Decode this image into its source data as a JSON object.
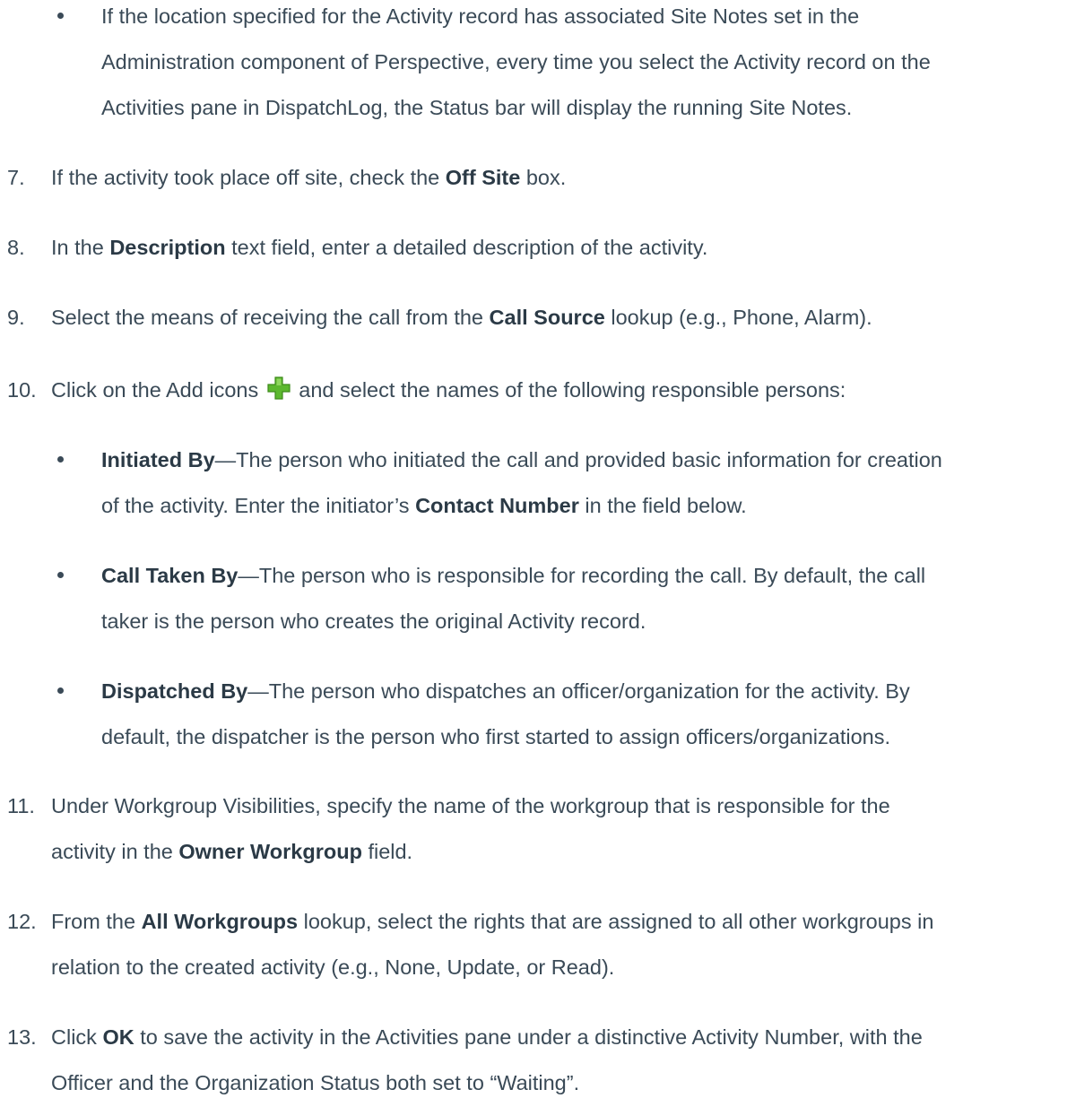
{
  "doc": {
    "bullet_site_notes": [
      "If the location specified for the Activity record has associated Site Notes set in the",
      "Administration component of Perspective, every time you select the Activity record on the",
      "Activities pane in DispatchLog, the Status bar will display the running Site Notes."
    ],
    "step7": {
      "num": "7.",
      "pre": "If the activity took place off site, check the ",
      "bold": "Off Site",
      "post": " box."
    },
    "step8": {
      "num": "8.",
      "pre": "In the ",
      "bold": "Description",
      "post": " text field, enter a detailed description of the activity."
    },
    "step9": {
      "num": "9.",
      "pre": "Select the means of receiving the call from the ",
      "bold": "Call Source",
      "post": " lookup (e.g., Phone, Alarm)."
    },
    "step10": {
      "num": "10.",
      "pre": "Click on the Add icons ",
      "icon": "add-plus-icon",
      "post": " and select the names of the following responsible persons:"
    },
    "initiated": {
      "bold": "Initiated By",
      "l1": "—The person who initiated the call and provided basic information for creation",
      "l2_pre": "of the activity. Enter the initiator’s ",
      "l2_bold": "Contact Number",
      "l2_post": " in the field below."
    },
    "taken": {
      "bold": "Call Taken By",
      "l1": "—The person who is responsible for recording the call. By default, the call",
      "l2": "taker is the person who creates the original Activity record."
    },
    "dispatched": {
      "bold": "Dispatched By",
      "l1": "—The person who dispatches an officer/organization for the activity. By",
      "l2": "default, the dispatcher is the person who first started to assign officers/organizations."
    },
    "step11": {
      "num": "11.",
      "l1": "Under Workgroup Visibilities, specify the name of the workgroup that is responsible for the",
      "l2_pre": "activity in the ",
      "l2_bold": "Owner Workgroup",
      "l2_post": " field."
    },
    "step12": {
      "num": "12.",
      "l1_pre": "From the ",
      "l1_bold": "All Workgroups",
      "l1_post": " lookup, select the rights that are assigned to all other workgroups in",
      "l2": "relation to the created activity (e.g., None, Update, or Read)."
    },
    "step13": {
      "num": "13.",
      "l1_pre": "Click ",
      "l1_bold": "OK",
      "l1_post": " to save the activity in the Activities pane under a distinctive Activity Number, with the",
      "l2": "Officer and the Organization Status both set to “Waiting”."
    }
  },
  "colors": {
    "text": "#3a4a57",
    "icon_green": "#5cb82e"
  }
}
